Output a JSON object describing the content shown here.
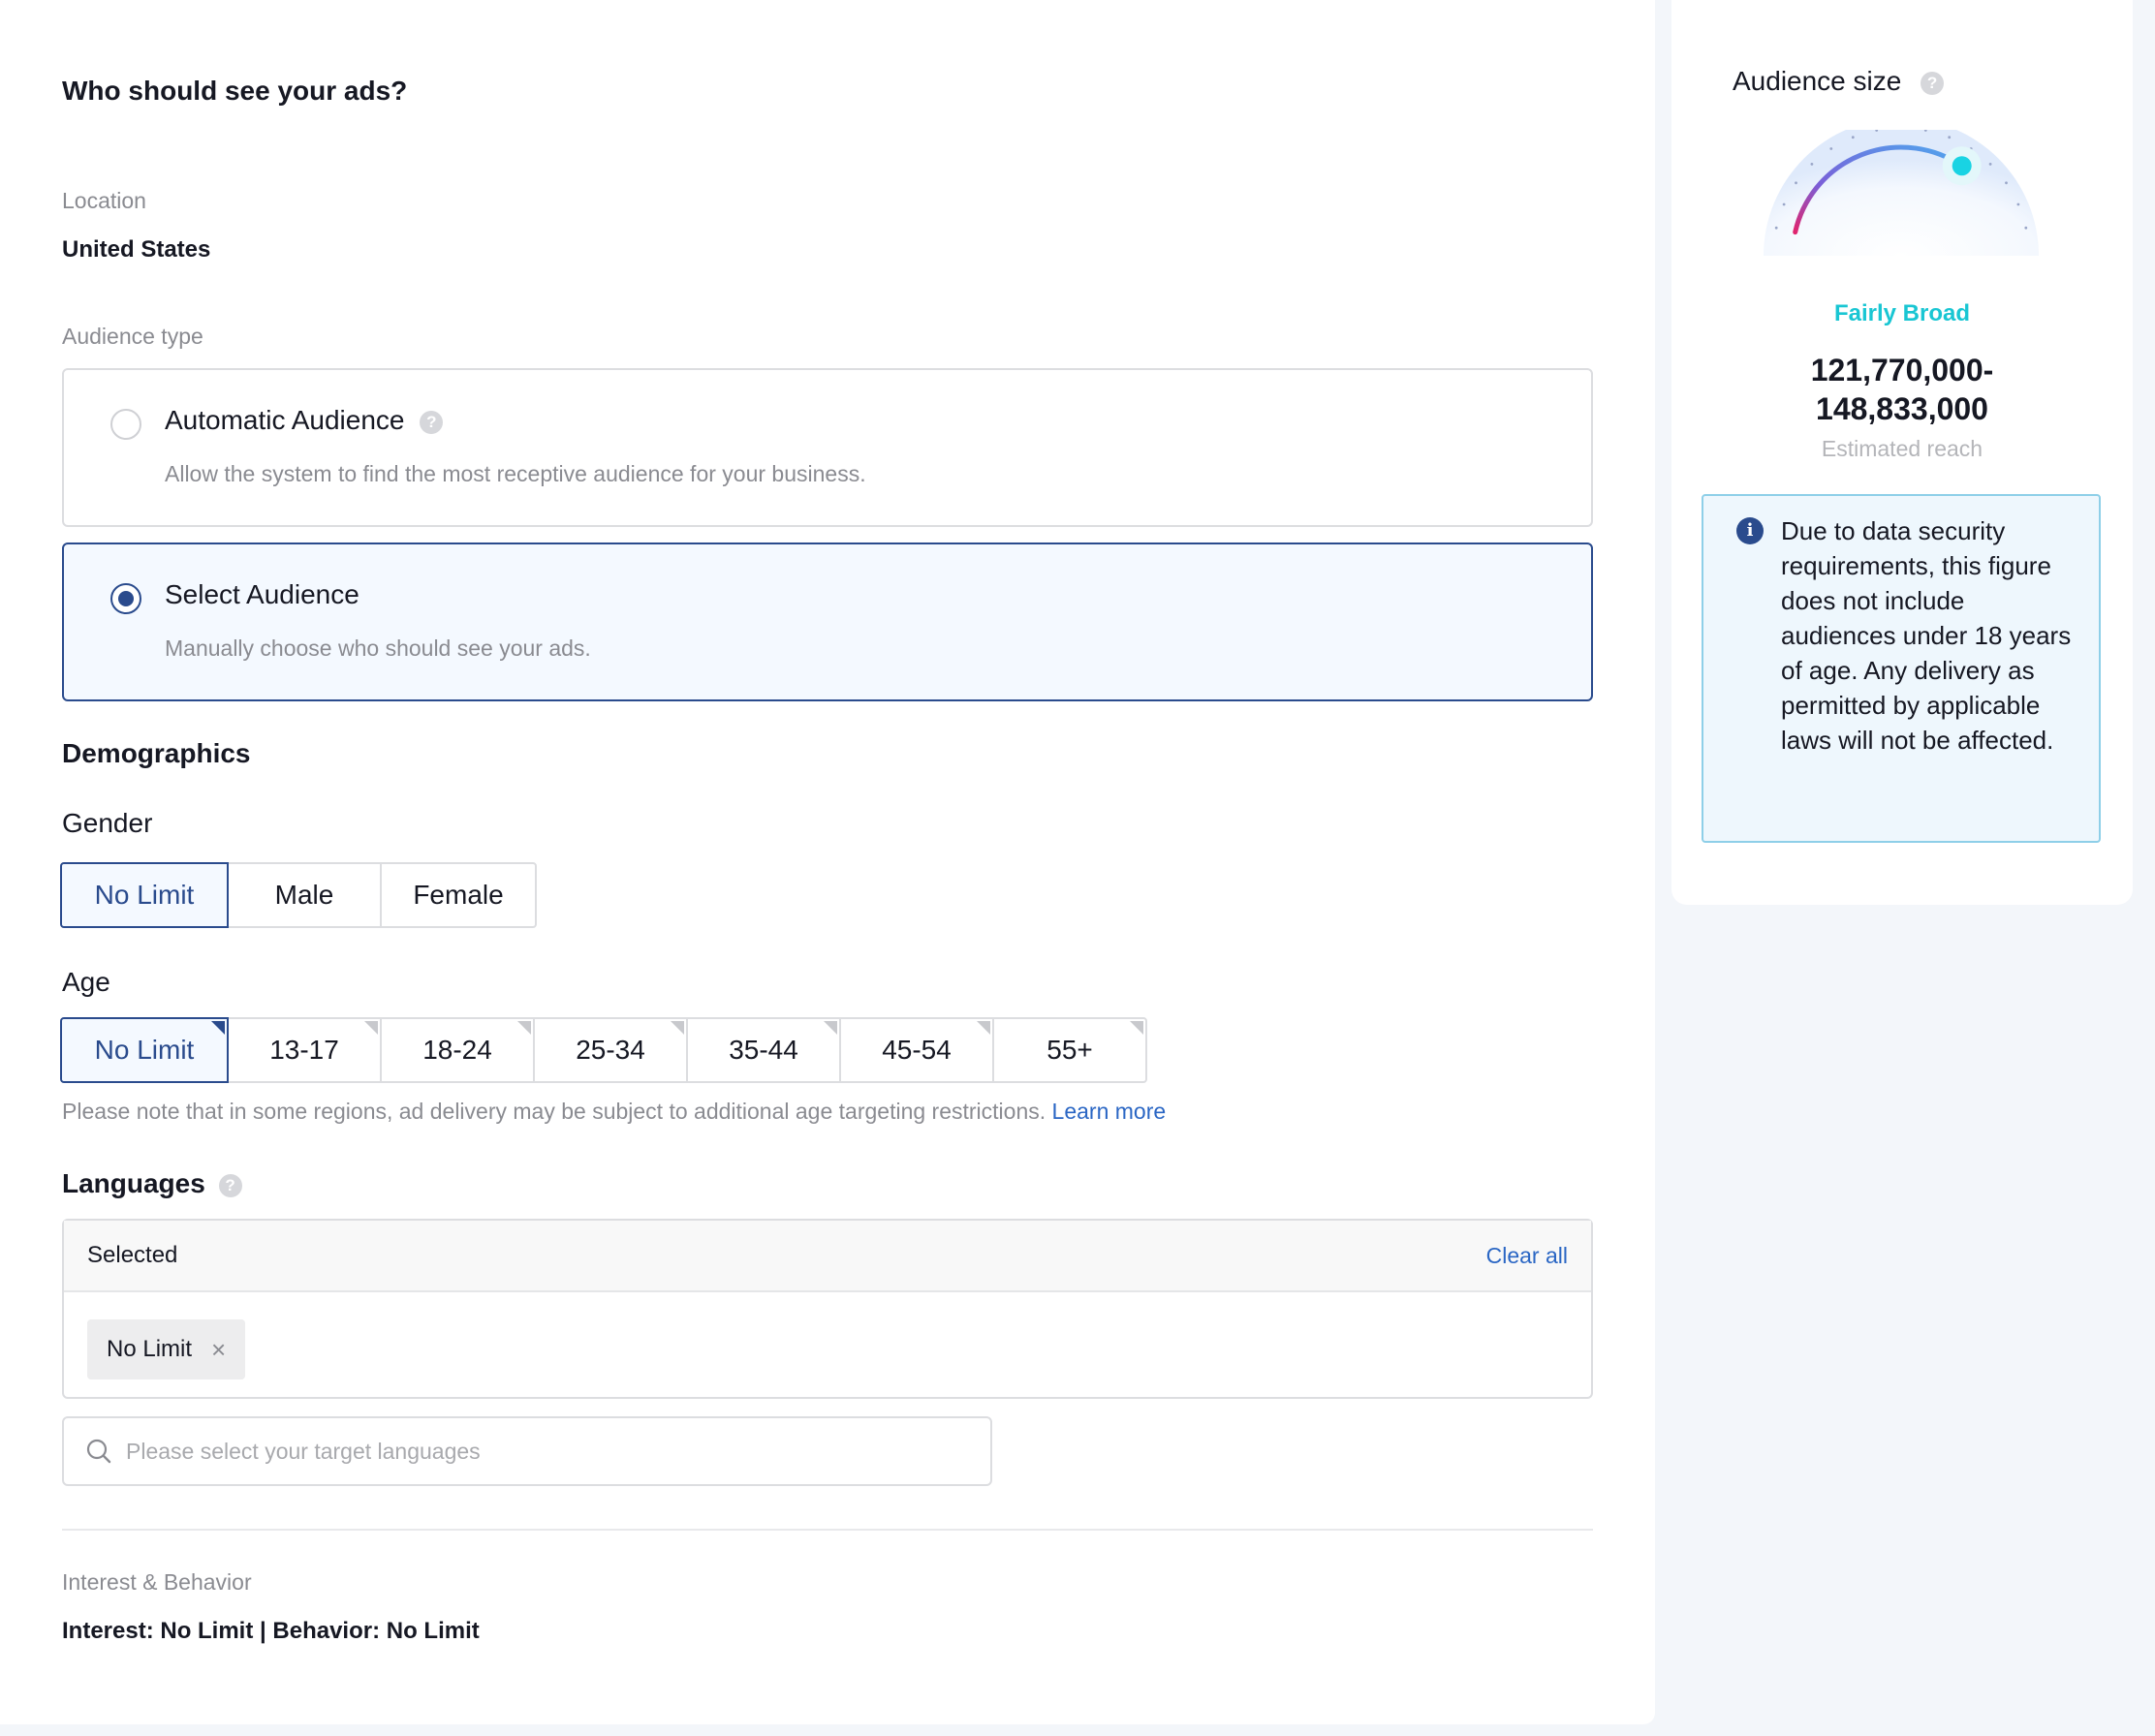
{
  "main": {
    "title": "Who should see your ads?",
    "location": {
      "label": "Location",
      "value": "United States"
    },
    "audience_type": {
      "label": "Audience type",
      "options": [
        {
          "title": "Automatic Audience",
          "description": "Allow the system to find the most receptive audience for your business.",
          "selected": false,
          "help": "?"
        },
        {
          "title": "Select Audience",
          "description": "Manually choose who should see your ads.",
          "selected": true
        }
      ]
    },
    "demographics": {
      "title": "Demographics",
      "gender": {
        "label": "Gender",
        "options": [
          "No Limit",
          "Male",
          "Female"
        ],
        "selected": "No Limit"
      },
      "age": {
        "label": "Age",
        "options": [
          "No Limit",
          "13-17",
          "18-24",
          "25-34",
          "35-44",
          "45-54",
          "55+"
        ],
        "selected": "No Limit"
      },
      "note": "Please note that in some regions, ad delivery may be subject to additional age targeting restrictions.",
      "learn_more": "Learn more"
    },
    "languages": {
      "label": "Languages",
      "help": "?",
      "selected_label": "Selected",
      "clear_all": "Clear all",
      "tags": [
        "No Limit"
      ],
      "search_placeholder": "Please select your target languages"
    },
    "interest": {
      "label": "Interest & Behavior",
      "value": "Interest: No Limit | Behavior: No Limit"
    }
  },
  "side": {
    "title": "Audience size",
    "help": "?",
    "gauge_level": 0.72,
    "reach_level": "Fairly Broad",
    "reach_range_line1": "121,770,000-",
    "reach_range_line2": "148,833,000",
    "reach_label": "Estimated reach",
    "info_icon": "i",
    "info_text": "Due to data security requirements, this figure does not include audiences under 18 years of age. Any delivery as permitted by applicable laws will not be affected."
  },
  "colors": {
    "accent": "#2a4b8d",
    "link": "#2a66c4",
    "reach": "#19c6d3"
  },
  "icons": {
    "search": "search-icon",
    "close": "close-icon",
    "help": "help-icon",
    "info": "info-icon"
  }
}
